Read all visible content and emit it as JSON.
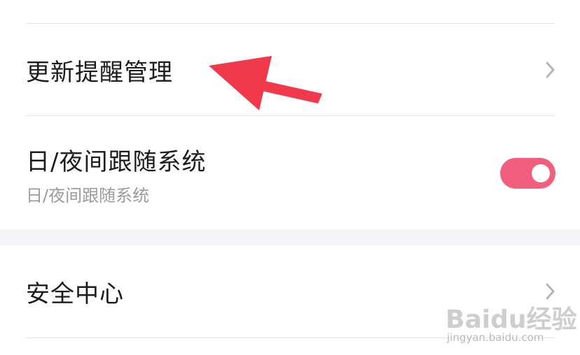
{
  "settings": {
    "items": [
      {
        "title": "更新提醒管理",
        "chevron_icon": "chevron-right-icon"
      },
      {
        "title": "日/夜间跟随系统",
        "subtitle": "日/夜间跟随系统",
        "toggle_on": true
      },
      {
        "title": "安全中心",
        "chevron_icon": "chevron-right-icon"
      }
    ]
  },
  "colors": {
    "toggle_on": "#f25e7e",
    "annotation_arrow": "#f03a4c",
    "chevron": "#b5b5b5"
  },
  "watermark": {
    "logo": "Baidu经验",
    "url": "jingyan.baidu.com"
  }
}
